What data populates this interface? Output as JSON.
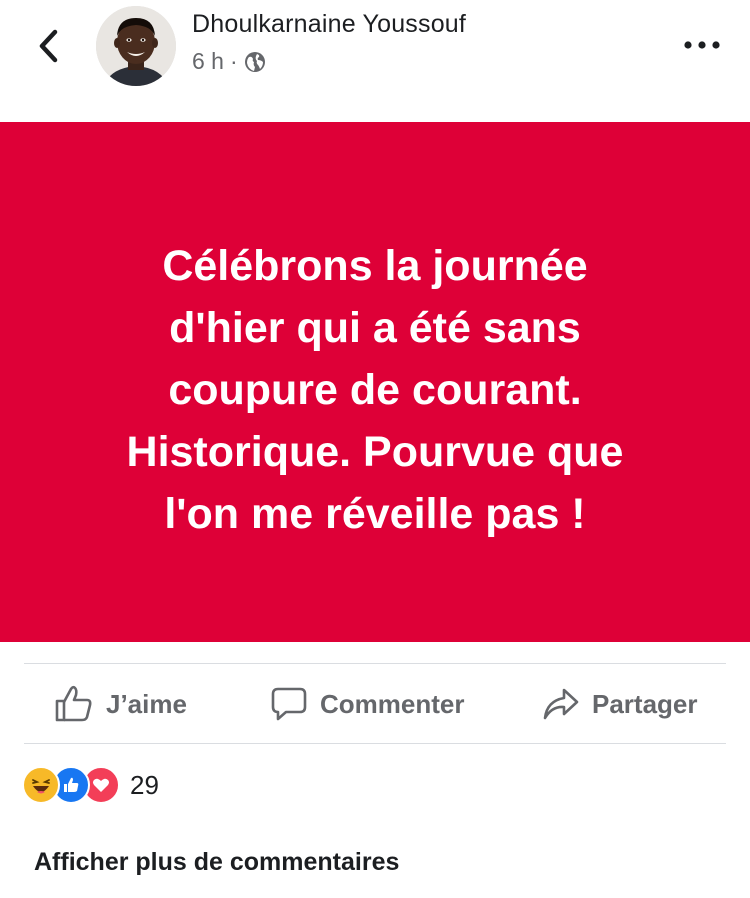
{
  "header": {
    "author_name": "Dhoulkarnaine Youssouf",
    "time_ago": "6 h",
    "separator": "·",
    "privacy_icon": "globe-icon",
    "back_icon": "chevron-left-icon",
    "more_icon": "more-horizontal-icon"
  },
  "post": {
    "background_color": "#de0037",
    "text_lines": [
      "Célébrons la journée",
      "d'hier qui a été sans",
      "coupure de courant.",
      "Historique. Pourvue que",
      "l'on me réveille pas !"
    ]
  },
  "actions": {
    "like_label": "J’aime",
    "comment_label": "Commenter",
    "share_label": "Partager"
  },
  "reactions": {
    "types": [
      "haha",
      "like",
      "love"
    ],
    "count": "29"
  },
  "comments": {
    "more_label": "Afficher plus de commentaires"
  }
}
